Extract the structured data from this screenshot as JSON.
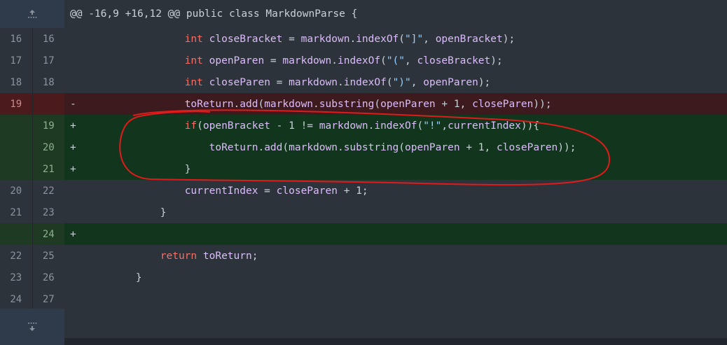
{
  "hunk_header": "@@ -16,9 +16,12 @@ public class MarkdownParse {",
  "icons": {
    "expand_up": "expand-up-icon",
    "expand_down": "expand-down-icon"
  },
  "rows": [
    {
      "type": "ctx",
      "old": "16",
      "new": "16",
      "sign": "",
      "indent": "                ",
      "tokens": [
        [
          "kw",
          "int"
        ],
        [
          "plain",
          " "
        ],
        [
          "id",
          "closeBracket"
        ],
        [
          "plain",
          " = "
        ],
        [
          "id",
          "markdown"
        ],
        [
          "plain",
          "."
        ],
        [
          "fn",
          "indexOf"
        ],
        [
          "plain",
          "("
        ],
        [
          "str",
          "\"]\""
        ],
        [
          "plain",
          ", "
        ],
        [
          "id",
          "openBracket"
        ],
        [
          "plain",
          ");"
        ]
      ]
    },
    {
      "type": "ctx",
      "old": "17",
      "new": "17",
      "sign": "",
      "indent": "                ",
      "tokens": [
        [
          "kw",
          "int"
        ],
        [
          "plain",
          " "
        ],
        [
          "id",
          "openParen"
        ],
        [
          "plain",
          " = "
        ],
        [
          "id",
          "markdown"
        ],
        [
          "plain",
          "."
        ],
        [
          "fn",
          "indexOf"
        ],
        [
          "plain",
          "("
        ],
        [
          "str",
          "\"(\""
        ],
        [
          "plain",
          ", "
        ],
        [
          "id",
          "closeBracket"
        ],
        [
          "plain",
          ");"
        ]
      ]
    },
    {
      "type": "ctx",
      "old": "18",
      "new": "18",
      "sign": "",
      "indent": "                ",
      "tokens": [
        [
          "kw",
          "int"
        ],
        [
          "plain",
          " "
        ],
        [
          "id",
          "closeParen"
        ],
        [
          "plain",
          " = "
        ],
        [
          "id",
          "markdown"
        ],
        [
          "plain",
          "."
        ],
        [
          "fn",
          "indexOf"
        ],
        [
          "plain",
          "("
        ],
        [
          "str",
          "\")\""
        ],
        [
          "plain",
          ", "
        ],
        [
          "id",
          "openParen"
        ],
        [
          "plain",
          ");"
        ]
      ]
    },
    {
      "type": "del",
      "old": "19",
      "new": "",
      "sign": "-",
      "indent": "                ",
      "tokens": [
        [
          "id",
          "toReturn"
        ],
        [
          "plain",
          "."
        ],
        [
          "fn",
          "add"
        ],
        [
          "plain",
          "("
        ],
        [
          "id",
          "markdown"
        ],
        [
          "plain",
          "."
        ],
        [
          "fn",
          "substring"
        ],
        [
          "plain",
          "("
        ],
        [
          "id",
          "openParen"
        ],
        [
          "plain",
          " + 1, "
        ],
        [
          "id",
          "closeParen"
        ],
        [
          "plain",
          "));"
        ]
      ]
    },
    {
      "type": "add",
      "old": "",
      "new": "19",
      "sign": "+",
      "indent": "                ",
      "tokens": [
        [
          "kw",
          "if"
        ],
        [
          "plain",
          "("
        ],
        [
          "id",
          "openBracket"
        ],
        [
          "plain",
          " - 1 != "
        ],
        [
          "id",
          "markdown"
        ],
        [
          "plain",
          "."
        ],
        [
          "fn",
          "indexOf"
        ],
        [
          "plain",
          "("
        ],
        [
          "str",
          "\"!\""
        ],
        [
          "plain",
          ","
        ],
        [
          "id",
          "currentIndex"
        ],
        [
          "plain",
          ")){"
        ]
      ]
    },
    {
      "type": "add",
      "old": "",
      "new": "20",
      "sign": "+",
      "indent": "                    ",
      "tokens": [
        [
          "id",
          "toReturn"
        ],
        [
          "plain",
          "."
        ],
        [
          "fn",
          "add"
        ],
        [
          "plain",
          "("
        ],
        [
          "id",
          "markdown"
        ],
        [
          "plain",
          "."
        ],
        [
          "fn",
          "substring"
        ],
        [
          "plain",
          "("
        ],
        [
          "id",
          "openParen"
        ],
        [
          "plain",
          " + 1, "
        ],
        [
          "id",
          "closeParen"
        ],
        [
          "plain",
          "));"
        ]
      ]
    },
    {
      "type": "add",
      "old": "",
      "new": "21",
      "sign": "+",
      "indent": "                ",
      "tokens": [
        [
          "plain",
          "}"
        ]
      ]
    },
    {
      "type": "ctx",
      "old": "20",
      "new": "22",
      "sign": "",
      "indent": "                ",
      "tokens": [
        [
          "id",
          "currentIndex"
        ],
        [
          "plain",
          " = "
        ],
        [
          "id",
          "closeParen"
        ],
        [
          "plain",
          " + 1;"
        ]
      ]
    },
    {
      "type": "ctx",
      "old": "21",
      "new": "23",
      "sign": "",
      "indent": "            ",
      "tokens": [
        [
          "plain",
          "}"
        ]
      ]
    },
    {
      "type": "add",
      "old": "",
      "new": "24",
      "sign": "+",
      "indent": "",
      "tokens": []
    },
    {
      "type": "ctx",
      "old": "22",
      "new": "25",
      "sign": "",
      "indent": "            ",
      "tokens": [
        [
          "kw",
          "return"
        ],
        [
          "plain",
          " "
        ],
        [
          "id",
          "toReturn"
        ],
        [
          "plain",
          ";"
        ]
      ]
    },
    {
      "type": "ctx",
      "old": "23",
      "new": "26",
      "sign": "",
      "indent": "        ",
      "tokens": [
        [
          "plain",
          "}"
        ]
      ]
    },
    {
      "type": "ctx",
      "old": "24",
      "new": "27",
      "sign": "",
      "indent": "",
      "tokens": []
    }
  ]
}
